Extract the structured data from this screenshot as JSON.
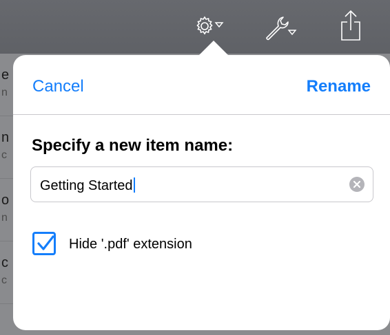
{
  "toolbar": {
    "icons": [
      "gear-menu-icon",
      "wrench-menu-icon",
      "share-icon"
    ]
  },
  "dialog": {
    "cancel_label": "Cancel",
    "rename_label": "Rename",
    "heading": "Specify a new item name:",
    "name_value": "Getting Started",
    "hide_extension_label": "Hide '.pdf' extension",
    "hide_extension_checked": true
  },
  "colors": {
    "accent": "#147efb",
    "toolbar": "#626469",
    "dim_background": "#8a8b8e"
  }
}
